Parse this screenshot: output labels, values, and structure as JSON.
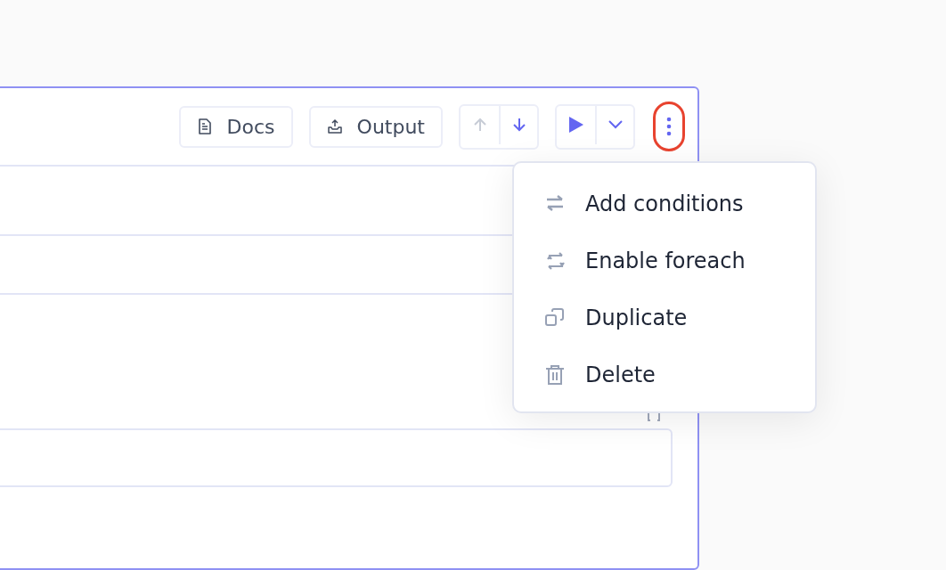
{
  "toolbar": {
    "buttons": [
      {
        "label": "Docs",
        "kind": "docs"
      },
      {
        "label": "Output",
        "kind": "output"
      }
    ],
    "move": [
      {
        "kind": "up",
        "disabled": true
      },
      {
        "kind": "down",
        "disabled": false
      }
    ],
    "more": {
      "highlighted": true
    }
  },
  "menu": {
    "items": [
      {
        "label": "Add conditions",
        "kind": "conditions"
      },
      {
        "label": "Enable foreach",
        "kind": "foreach"
      },
      {
        "label": "Duplicate",
        "kind": "duplicate"
      },
      {
        "label": "Delete",
        "kind": "delete"
      }
    ]
  }
}
